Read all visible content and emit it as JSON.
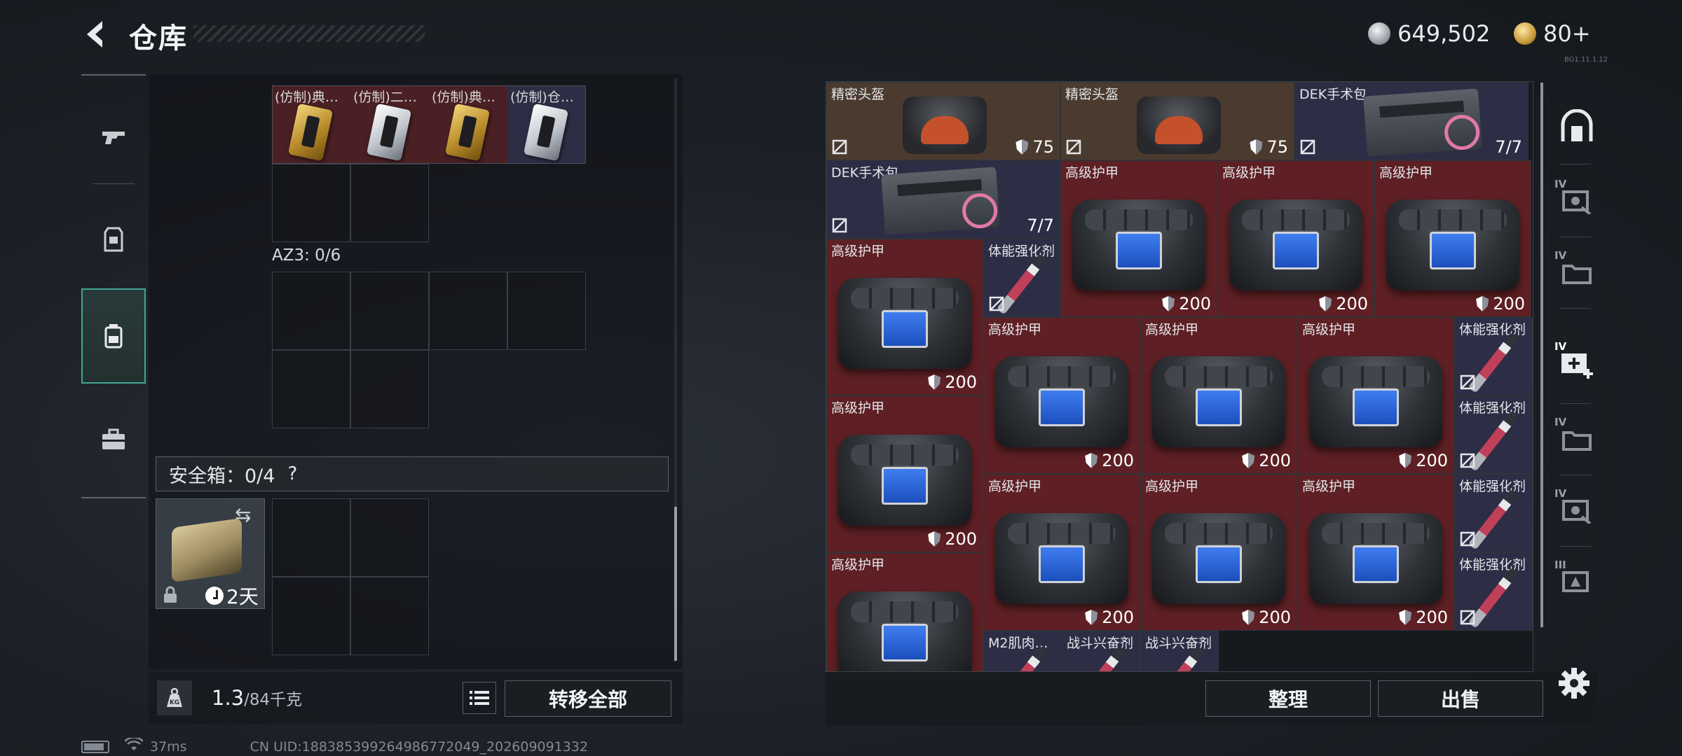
{
  "header": {
    "title": "仓库",
    "currency_1": "649,502",
    "currency_2": "80+",
    "version": "BG1.11.1.12"
  },
  "left_nav": {
    "items": [
      {
        "id": "weapon",
        "icon": "pistol-icon"
      },
      {
        "id": "armor",
        "icon": "vest-icon"
      },
      {
        "id": "backpack",
        "icon": "backpack-icon",
        "active": true
      },
      {
        "id": "case",
        "icon": "briefcase-icon"
      }
    ]
  },
  "containers": {
    "top_items": [
      {
        "label": "(仿制)典…",
        "style": "gold"
      },
      {
        "label": "(仿制)二…",
        "style": "silver"
      },
      {
        "label": "(仿制)典…",
        "style": "gold"
      },
      {
        "label": "(仿制)仓…",
        "style": "silver"
      }
    ],
    "az3_label": "AZ3: 0/6",
    "safe_box": {
      "label": "安全箱：0/4",
      "help": "?",
      "timer": "2天"
    }
  },
  "weight": {
    "current": "1.3",
    "max": "/84千克",
    "kg_badge": "KG"
  },
  "buttons": {
    "transfer_all": "转移全部",
    "sort": "整理",
    "sell": "出售"
  },
  "status": {
    "ping": "37ms",
    "uid": "CN UID:188385399264986772049_202609091332"
  },
  "stash": {
    "items": [
      {
        "name": "精密头盔",
        "type": "helmet",
        "stat": "75",
        "bg": "brown"
      },
      {
        "name": "精密头盔",
        "type": "helmet",
        "stat": "75",
        "bg": "brown"
      },
      {
        "name": "DEK手术包",
        "type": "medkit",
        "stat": "7/7",
        "bg": "purple"
      },
      {
        "name": "DEK手术包",
        "type": "medkit",
        "stat": "7/7",
        "bg": "purple"
      },
      {
        "name": "高级护甲",
        "type": "armor",
        "stat": "200",
        "bg": "red"
      },
      {
        "name": "高级护甲",
        "type": "armor",
        "stat": "200",
        "bg": "red"
      },
      {
        "name": "高级护甲",
        "type": "armor",
        "stat": "200",
        "bg": "red"
      },
      {
        "name": "高级护甲",
        "type": "armor",
        "stat": "200",
        "bg": "red"
      },
      {
        "name": "体能强化剂",
        "type": "syringe",
        "stat": "",
        "bg": "purple"
      },
      {
        "name": "高级护甲",
        "type": "armor",
        "stat": "200",
        "bg": "red"
      },
      {
        "name": "高级护甲",
        "type": "armor",
        "stat": "200",
        "bg": "red"
      },
      {
        "name": "高级护甲",
        "type": "armor",
        "stat": "200",
        "bg": "red"
      },
      {
        "name": "体能强化剂",
        "type": "syringe",
        "stat": "",
        "bg": "purple"
      },
      {
        "name": "高级护甲",
        "type": "armor",
        "stat": "200",
        "bg": "red"
      },
      {
        "name": "体能强化剂",
        "type": "syringe",
        "stat": "",
        "bg": "purple"
      },
      {
        "name": "高级护甲",
        "type": "armor",
        "stat": "200",
        "bg": "red"
      },
      {
        "name": "高级护甲",
        "type": "armor",
        "stat": "200",
        "bg": "red"
      },
      {
        "name": "高级护甲",
        "type": "armor",
        "stat": "200",
        "bg": "red"
      },
      {
        "name": "体能强化剂",
        "type": "syringe",
        "stat": "",
        "bg": "purple"
      },
      {
        "name": "高级护甲",
        "type": "armor",
        "stat": "",
        "bg": "red"
      },
      {
        "name": "体能强化剂",
        "type": "syringe",
        "stat": "",
        "bg": "purple"
      },
      {
        "name": "M2肌肉…",
        "type": "syringe",
        "stat": "",
        "bg": "purple"
      },
      {
        "name": "战斗兴奋剂",
        "type": "syringe",
        "stat": "",
        "bg": "purple"
      },
      {
        "name": "战斗兴奋剂",
        "type": "syringe",
        "stat": "",
        "bg": "purple"
      }
    ]
  },
  "right_nav": {
    "items": [
      {
        "tier": "",
        "icon": "vault-icon"
      },
      {
        "tier": "IV",
        "icon": "safe-box-icon"
      },
      {
        "tier": "IV",
        "icon": "folder-icon"
      },
      {
        "tier": "IV",
        "icon": "medical-case-icon"
      },
      {
        "tier": "IV",
        "icon": "folder-icon"
      },
      {
        "tier": "IV",
        "icon": "safe-box-icon"
      },
      {
        "tier": "III",
        "icon": "ammo-case-icon"
      }
    ]
  },
  "colors": {
    "accent": "#3fa893",
    "item_red": "#5e2024",
    "item_brown": "#4b3b2f",
    "item_purple": "#2d2e45"
  }
}
